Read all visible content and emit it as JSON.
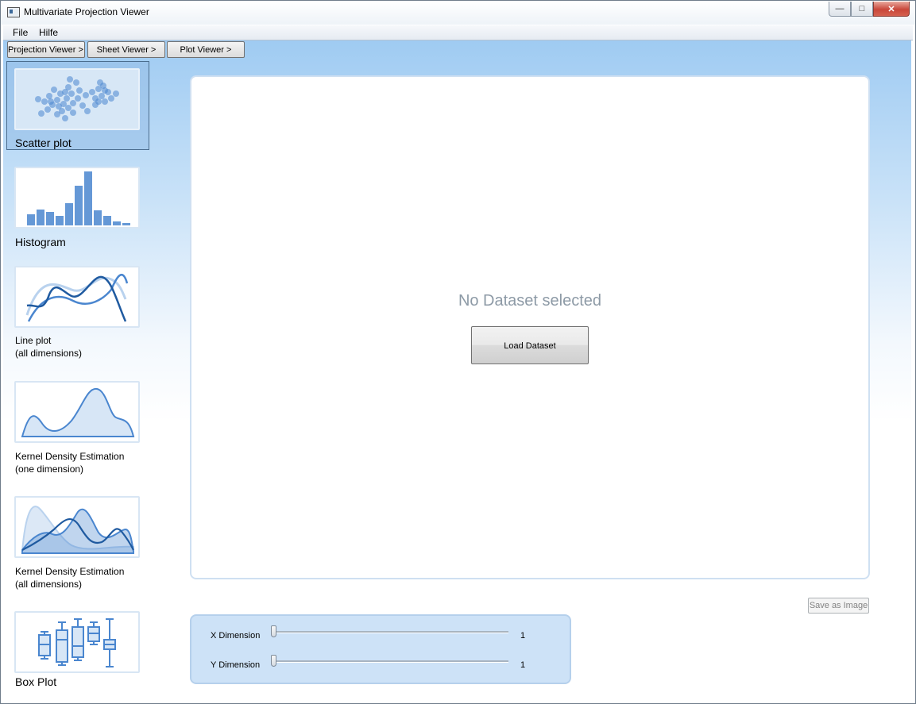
{
  "window": {
    "title": "Multivariate Projection Viewer"
  },
  "menu": {
    "file": "File",
    "help": "Hilfe"
  },
  "nav": {
    "projection_viewer": "Projection Viewer >",
    "sheet_viewer": "Sheet Viewer >",
    "plot_viewer": "Plot Viewer >"
  },
  "plot_types": {
    "scatter": "Scatter plot",
    "histogram": "Histogram",
    "line_1": "Line plot",
    "line_2": "(all dimensions)",
    "kde_one_1": "Kernel Density Estimation",
    "kde_one_2": "(one dimension)",
    "kde_all_1": "Kernel Density Estimation",
    "kde_all_2": "(all dimensions)",
    "box": "Box Plot",
    "selected": "scatter"
  },
  "main": {
    "empty_message": "No Dataset selected",
    "load_button": "Load Dataset",
    "save_button": "Save as Image"
  },
  "dimensions": {
    "x_label": "X Dimension",
    "x_value": "1",
    "y_label": "Y Dimension",
    "y_value": "1"
  },
  "colors": {
    "accent": "#4a86cf",
    "dark_series": "#1f5aa0",
    "light_series": "#b9d2ee"
  }
}
